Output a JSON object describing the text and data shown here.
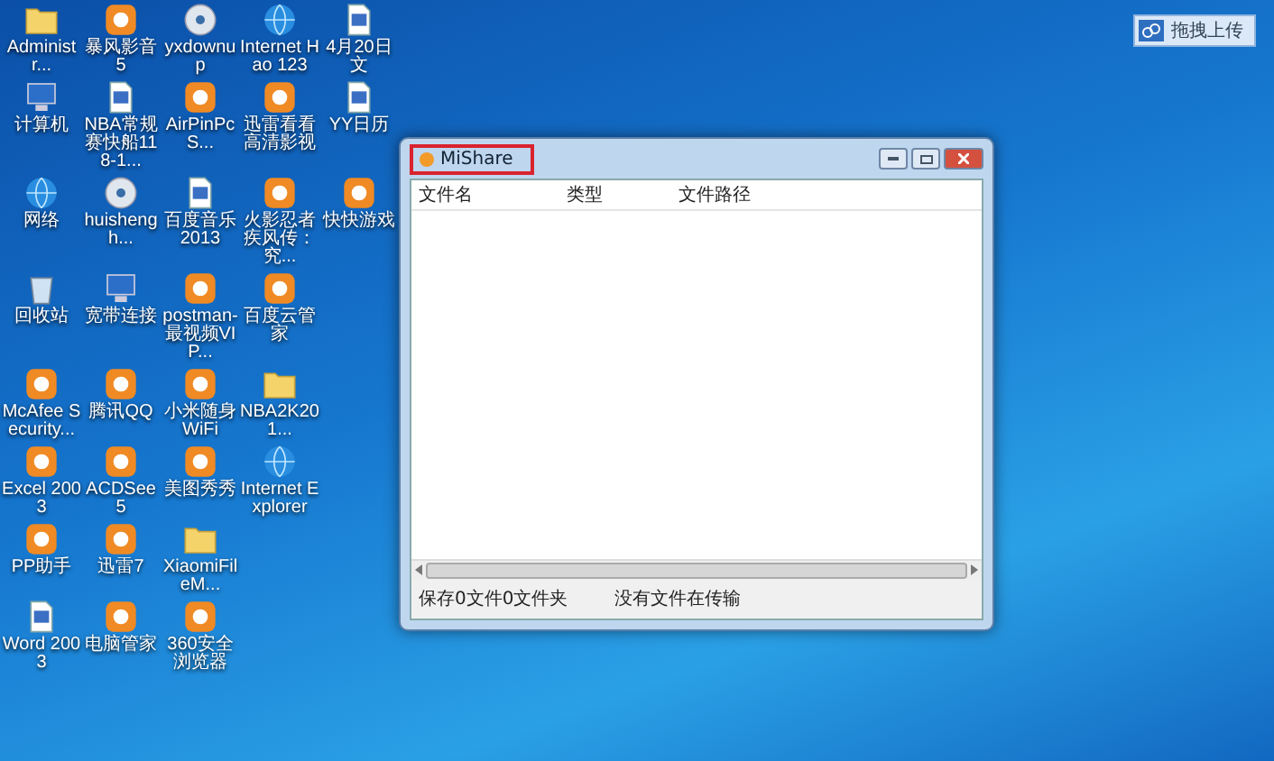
{
  "desktop_icons": [
    {
      "label": "Administr...",
      "kind": "folder"
    },
    {
      "label": "暴风影音5",
      "kind": "app"
    },
    {
      "label": "yxdownup",
      "kind": "disc"
    },
    {
      "label": "Internet Hao 123",
      "kind": "globe"
    },
    {
      "label": "4月20日文",
      "kind": "document"
    },
    {
      "label": "计算机",
      "kind": "computer"
    },
    {
      "label": "NBA常规赛快船118-1...",
      "kind": "document"
    },
    {
      "label": "AirPinPcS...",
      "kind": "app"
    },
    {
      "label": "迅雷看看高清影视",
      "kind": "app"
    },
    {
      "label": "YY日历",
      "kind": "document"
    },
    {
      "label": "网络",
      "kind": "globe"
    },
    {
      "label": "huishengh...",
      "kind": "disc"
    },
    {
      "label": "百度音乐2013",
      "kind": "document"
    },
    {
      "label": "火影忍者疾风传：究...",
      "kind": "app"
    },
    {
      "label": "快快游戏",
      "kind": "app"
    },
    {
      "label": "回收站",
      "kind": "bin"
    },
    {
      "label": "宽带连接",
      "kind": "computer"
    },
    {
      "label": "postman-最视频VIP...",
      "kind": "app"
    },
    {
      "label": "百度云管家",
      "kind": "app"
    },
    {
      "kind": "none"
    },
    {
      "label": "McAfee Security...",
      "kind": "app"
    },
    {
      "label": "腾讯QQ",
      "kind": "app"
    },
    {
      "label": "小米随身WiFi",
      "kind": "app"
    },
    {
      "label": "NBA2K201...",
      "kind": "folder"
    },
    {
      "kind": "none"
    },
    {
      "label": "Excel 2003",
      "kind": "app"
    },
    {
      "label": "ACDSee5",
      "kind": "app"
    },
    {
      "label": "美图秀秀",
      "kind": "app"
    },
    {
      "label": "Internet Explorer",
      "kind": "globe"
    },
    {
      "kind": "none"
    },
    {
      "label": "PP助手",
      "kind": "app"
    },
    {
      "label": "迅雷7",
      "kind": "app"
    },
    {
      "label": "XiaomiFileM...",
      "kind": "folder"
    },
    {
      "kind": "none"
    },
    {
      "kind": "none"
    },
    {
      "label": "Word 2003",
      "kind": "document"
    },
    {
      "label": "电脑管家",
      "kind": "app"
    },
    {
      "label": "360安全浏览器",
      "kind": "app"
    }
  ],
  "upload_button": {
    "label": "拖拽上传"
  },
  "window": {
    "title": "MiShare",
    "columns": [
      "文件名",
      "类型",
      "文件路径"
    ],
    "status": [
      "保存0文件0文件夹",
      "没有文件在传输"
    ]
  }
}
